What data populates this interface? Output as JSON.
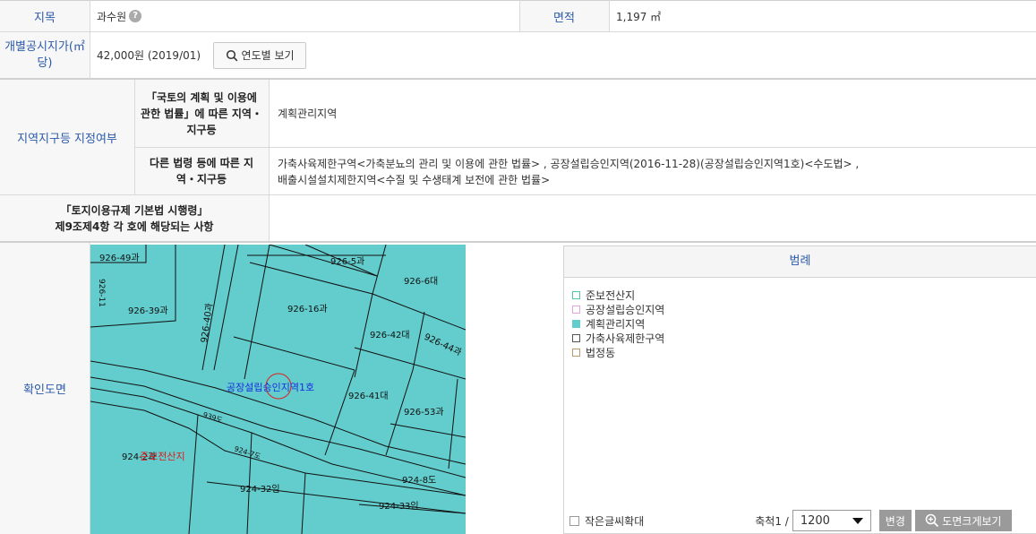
{
  "info": {
    "jimok_label": "지목",
    "jimok_value": "과수원",
    "area_label": "면적",
    "area_value": "1,197 ㎡",
    "price_label": "개별공시지가(㎡당)",
    "price_value": "42,000원 (2019/01)",
    "year_button": "연도별 보기"
  },
  "zoning": {
    "section_label": "지역지구등 지정여부",
    "national_law_label": "「국토의 계획 및 이용에 관한 법률」에 따른 지역・지구등",
    "national_law_value": "계획관리지역",
    "other_law_label": "다른 법령 등에 따른 지역・지구등",
    "other_law_value_1": "가축사육제한구역<가축분뇨의 관리 및 이용에 관한 법률> , 공장설립승인지역(2016-11-28)(공장설립승인지역1호)<수도법> ,",
    "other_law_value_2": "배출시설설치제한지역<수질 및 수생태계 보전에 관한 법률>",
    "decree_label_1": "「토지이용규제 기본법 시행령」",
    "decree_label_2": "제9조제4항 각 호에 해당되는 사항",
    "decree_value": ""
  },
  "map": {
    "section_label": "확인도면",
    "map_color": "#63cccc",
    "parcels": [
      "926-49과",
      "926-5과",
      "926-6대",
      "926-39과",
      "926-40과",
      "926-16과",
      "926-42대",
      "926-44과",
      "926-41대",
      "926-53과",
      "939도",
      "924-7도",
      "924-2과",
      "924-32임",
      "924-8도",
      "924-33임",
      "926-11"
    ],
    "overlay_blue": "공장설립승인지역1호",
    "overlay_red": "준보전산지"
  },
  "legend": {
    "title": "범례",
    "items": [
      {
        "label": "준보전산지",
        "color": "#4fc6a8",
        "filled": false
      },
      {
        "label": "공장설립승인지역",
        "color": "#e6a3e0",
        "filled": false
      },
      {
        "label": "계획관리지역",
        "color": "#63cccc",
        "filled": true
      },
      {
        "label": "가축사육제한구역",
        "color": "#555555",
        "filled": false
      },
      {
        "label": "법정동",
        "color": "#b89a6a",
        "filled": false
      }
    ],
    "small_text_label": "작은글씨확대",
    "scale_label": "축척1 /",
    "scale_value": "1200",
    "change_button": "변경",
    "enlarge_button": "도면크게보기"
  }
}
